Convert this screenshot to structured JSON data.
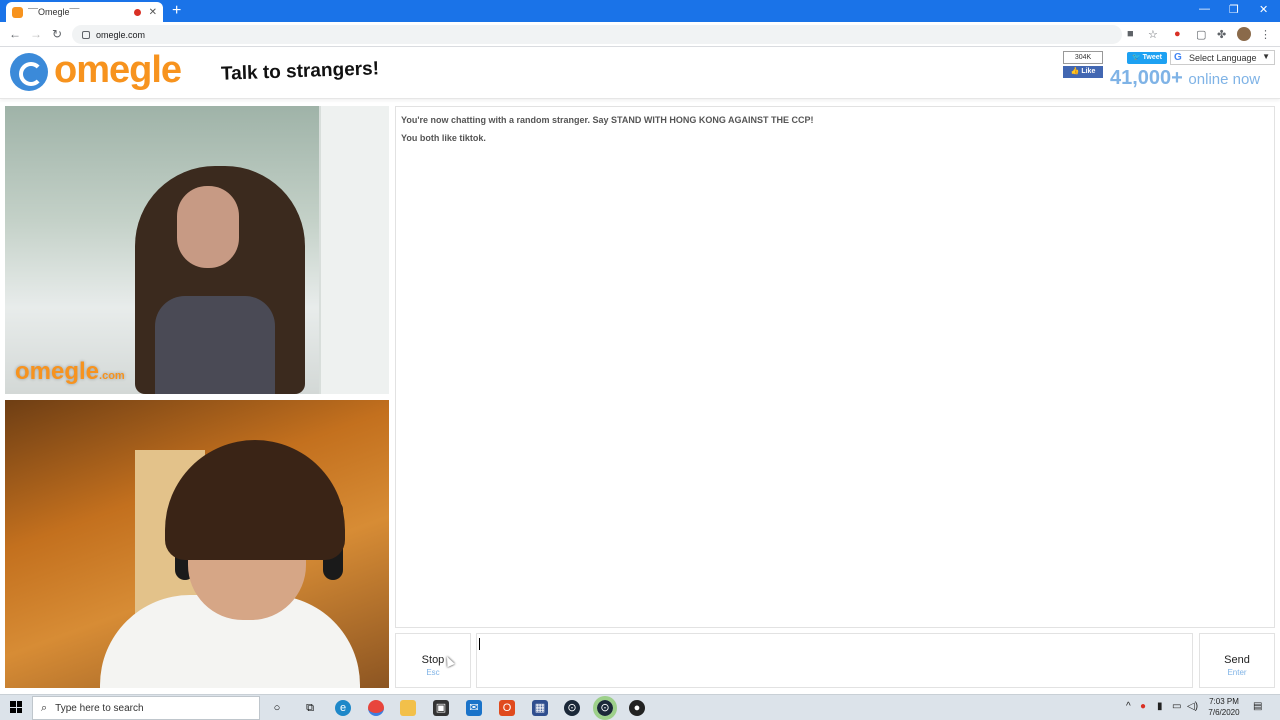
{
  "browser": {
    "tab_title": "¯¯Omegle¯¯",
    "tab_close": "✕",
    "url": "omegle.com",
    "new_tab": "+"
  },
  "header": {
    "logo_text": "omegle",
    "tagline": "Talk to strangers!",
    "fb_count": "304K",
    "fb_like": "Like",
    "tweet": "Tweet",
    "language_label": "Select Language",
    "online_count": "41,000+",
    "online_label": "online now"
  },
  "videos": {
    "watermark": "omegle",
    "watermark_suffix": ".com"
  },
  "chat": {
    "messages": [
      "You're now chatting with a random stranger. Say STAND WITH HONG KONG AGAINST THE CCP!",
      "You both like tiktok."
    ],
    "stop_label": "Stop",
    "stop_hint": "Esc",
    "send_label": "Send",
    "send_hint": "Enter",
    "input_value": ""
  },
  "taskbar": {
    "search_placeholder": "Type here to search",
    "time": "7:03 PM",
    "date": "7/6/2020"
  }
}
